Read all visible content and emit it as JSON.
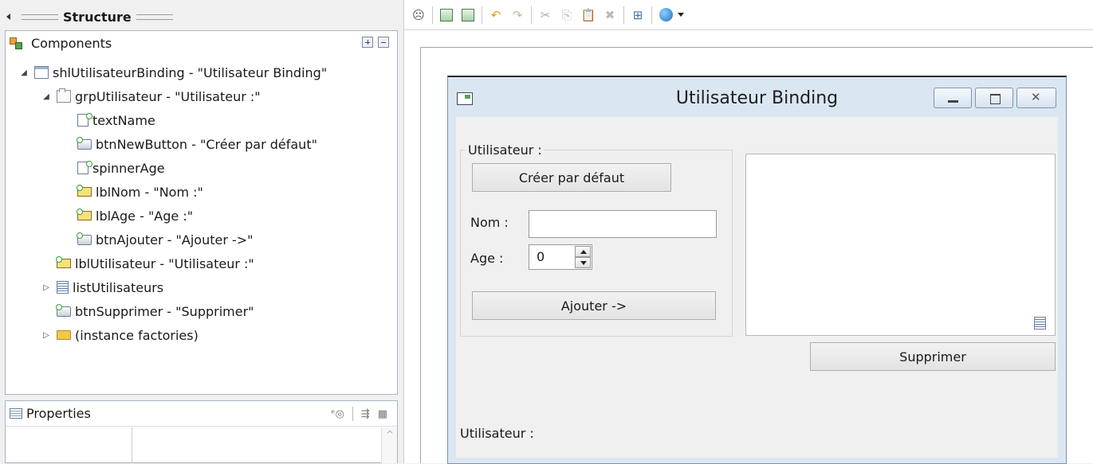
{
  "structure": {
    "title": "Structure",
    "components": {
      "label": "Components",
      "tree": [
        {
          "text": "shlUtilisateurBinding - \"Utilisateur Binding\""
        },
        {
          "text": "grpUtilisateur - \"Utilisateur :\""
        },
        {
          "text": "textName"
        },
        {
          "text": "btnNewButton - \"Créer par défaut\""
        },
        {
          "text": "spinnerAge"
        },
        {
          "text": "lblNom - \"Nom :\""
        },
        {
          "text": "lblAge - \"Age :\""
        },
        {
          "text": "btnAjouter - \"Ajouter ->\""
        },
        {
          "text": "lblUtilisateur - \"Utilisateur :\""
        },
        {
          "text": "listUtilisateurs"
        },
        {
          "text": "btnSupprimer - \"Supprimer\""
        },
        {
          "text": "(instance factories)"
        }
      ]
    },
    "properties": {
      "label": "Properties"
    }
  },
  "designer": {
    "window": {
      "title": "Utilisateur Binding",
      "group_title": "Utilisateur :",
      "create_default_button": "Créer par défaut",
      "name_label": "Nom :",
      "name_value": "",
      "age_label": "Age :",
      "age_value": "0",
      "add_button": "Ajouter ->",
      "delete_button": "Supprimer",
      "bottom_label": "Utilisateur :"
    }
  }
}
